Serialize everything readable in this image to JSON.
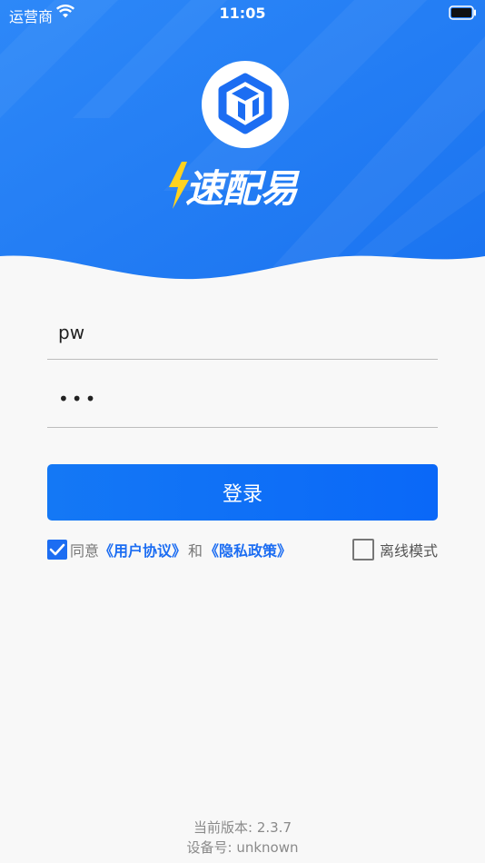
{
  "status_bar": {
    "carrier": "运营商",
    "time": "11:05"
  },
  "brand": {
    "name": "速配易",
    "accent_color": "#1c6df2"
  },
  "login": {
    "username_value": "pw",
    "password_value": "•••",
    "submit_label": "登录"
  },
  "agreement": {
    "checked": true,
    "prefix": "同意",
    "user_agreement": "《用户协议》",
    "conjunction": "和",
    "privacy_policy": "《隐私政策》"
  },
  "offline": {
    "checked": false,
    "label": "离线模式"
  },
  "footer": {
    "version": "当前版本: 2.3.7",
    "device": "设备号: unknown"
  }
}
